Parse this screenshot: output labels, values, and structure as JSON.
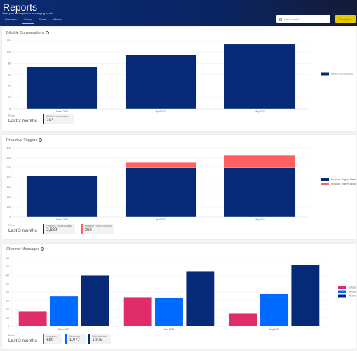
{
  "header": {
    "title": "Reports",
    "subtitle": "View your workspace's messaging trends",
    "tabs": [
      {
        "label": "Overview",
        "active": false
      },
      {
        "label": "Usage",
        "active": true
      },
      {
        "label": "Flows",
        "active": false
      },
      {
        "label": "Intents",
        "active": false
      }
    ],
    "date_range": "Last 3 months",
    "download_label": "Download"
  },
  "colors": {
    "navy": "#072a78",
    "coral": "#ff6161",
    "pink": "#e02d69",
    "blue": "#0069ff",
    "accent_yellow": "#e6c800"
  },
  "cards": {
    "billable": {
      "title": "Billable Conversations",
      "period_label": "Period",
      "period_value": "Last 3 months",
      "stats": [
        {
          "label": "Billable Conversations",
          "value": "283",
          "color": "#072a78"
        }
      ]
    },
    "proactive": {
      "title": "Proactive Triggers",
      "period_label": "Period",
      "period_value": "Last 3 months",
      "stats": [
        {
          "label": "Proactive Triggers Started",
          "value": "2,839",
          "color": "#072a78"
        },
        {
          "label": "Proactive Triggers Blocked",
          "value": "368",
          "color": "#ff6161"
        }
      ]
    },
    "channel": {
      "title": "Channel Messages",
      "period_label": "Period",
      "period_value": "Last 3 months",
      "stats": [
        {
          "label": "Instagram",
          "value": "680",
          "color": "#e02d69"
        },
        {
          "label": "Messenger",
          "value": "1,077",
          "color": "#0069ff"
        },
        {
          "label": "Web Assistant",
          "value": "1,975",
          "color": "#072a78"
        }
      ]
    }
  },
  "chart_data": [
    {
      "type": "bar",
      "title": "Billable Conversations",
      "categories": [
        "March 2022",
        "April 2022",
        "May 2022"
      ],
      "series": [
        {
          "name": "Billable Conversations",
          "values": [
            74,
            95,
            114
          ],
          "color": "#072a78"
        }
      ],
      "ylim": [
        0,
        120
      ],
      "yticks": [
        0,
        20,
        40,
        60,
        80,
        100,
        120
      ],
      "grid": true,
      "legend": "right"
    },
    {
      "type": "bar",
      "stacked": true,
      "title": "Proactive Triggers",
      "categories": [
        "March 2022",
        "April 2022",
        "May 2022"
      ],
      "series": [
        {
          "name": "Proactive Triggers Started",
          "values": [
            839,
            1000,
            1000
          ],
          "color": "#072a78"
        },
        {
          "name": "Proactive Triggers Blocked",
          "values": [
            0,
            112,
            256
          ],
          "color": "#ff6161"
        }
      ],
      "ylim": [
        0,
        1400
      ],
      "yticks": [
        0,
        200,
        400,
        600,
        800,
        1000,
        1200,
        1400
      ],
      "grid": true,
      "legend": "right"
    },
    {
      "type": "bar",
      "title": "Channel Messages",
      "categories": [
        "March 2022",
        "April 2022",
        "May 2022"
      ],
      "series": [
        {
          "name": "Instagram",
          "values": [
            180,
            345,
            155
          ],
          "color": "#e02d69"
        },
        {
          "name": "Messenger",
          "values": [
            355,
            340,
            382
          ],
          "color": "#0069ff"
        },
        {
          "name": "Web Assistant",
          "values": [
            600,
            650,
            725
          ],
          "color": "#072a78"
        }
      ],
      "ylim": [
        0,
        800
      ],
      "yticks": [
        0,
        100,
        200,
        300,
        400,
        500,
        600,
        700,
        800
      ],
      "grid": true,
      "legend": "right"
    }
  ]
}
